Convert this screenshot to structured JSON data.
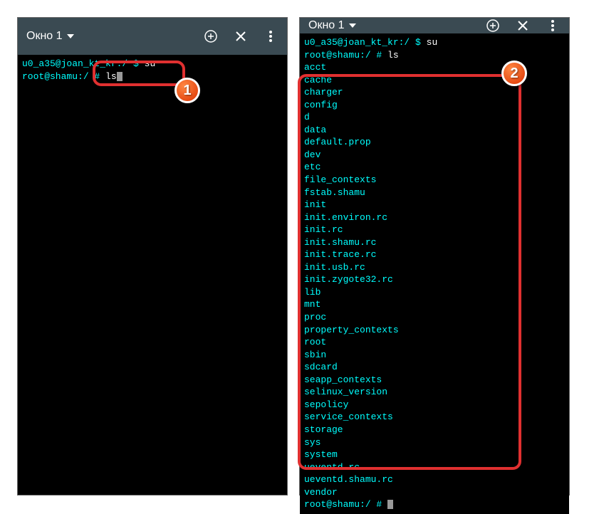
{
  "left": {
    "title": "Окно 1",
    "prompt1_user": "u0_a35@joan_kt_kr:/ $ ",
    "prompt1_cmd": "su",
    "prompt2_user": "root@shamu:/ # ",
    "prompt2_cmd": "ls"
  },
  "right": {
    "title": "Окно 1",
    "prompt1_user": "u0_a35@joan_kt_kr:/ $ ",
    "prompt1_cmd": "su",
    "prompt2_user": "root@shamu:/ # ",
    "prompt2_cmd": "ls",
    "output": "acct\ncache\ncharger\nconfig\nd\ndata\ndefault.prop\ndev\netc\nfile_contexts\nfstab.shamu\ninit\ninit.environ.rc\ninit.rc\ninit.shamu.rc\ninit.trace.rc\ninit.usb.rc\ninit.zygote32.rc\nlib\nmnt\nproc\nproperty_contexts\nroot\nsbin\nsdcard\nseapp_contexts\nselinux_version\nsepolicy\nservice_contexts\nstorage\nsys\nsystem\nueventd.rc\nueventd.shamu.rc\nvendor",
    "prompt3_user": "root@shamu:/ # "
  },
  "badges": {
    "one": "1",
    "two": "2"
  }
}
